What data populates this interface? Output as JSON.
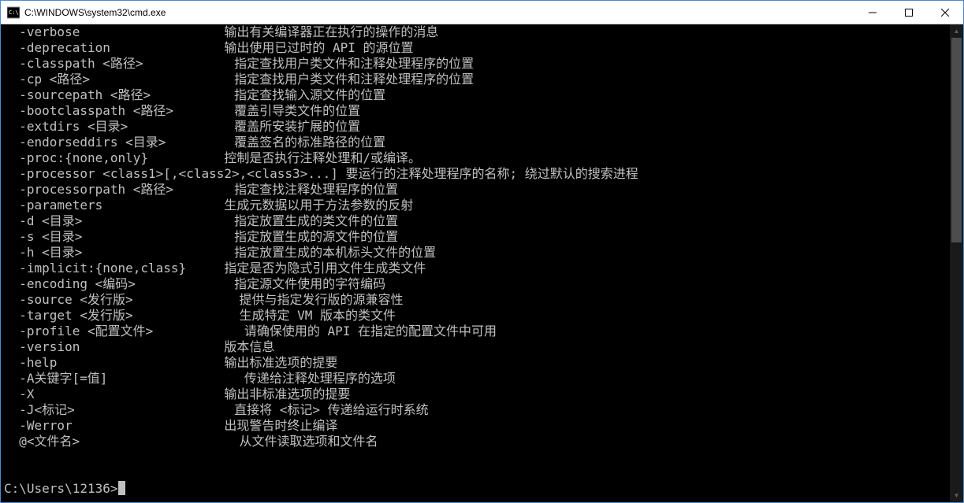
{
  "window": {
    "title": "C:\\WINDOWS\\system32\\cmd.exe"
  },
  "terminal": {
    "lines": [
      "  -verbose                   输出有关编译器正在执行的操作的消息",
      "  -deprecation               输出使用已过时的 API 的源位置",
      "  -classpath <路径>            指定查找用户类文件和注释处理程序的位置",
      "  -cp <路径>                   指定查找用户类文件和注释处理程序的位置",
      "  -sourcepath <路径>           指定查找输入源文件的位置",
      "  -bootclasspath <路径>        覆盖引导类文件的位置",
      "  -extdirs <目录>              覆盖所安装扩展的位置",
      "  -endorseddirs <目录>         覆盖签名的标准路径的位置",
      "  -proc:{none,only}          控制是否执行注释处理和/或编译。",
      "  -processor <class1>[,<class2>,<class3>...] 要运行的注释处理程序的名称; 绕过默认的搜索进程",
      "  -processorpath <路径>        指定查找注释处理程序的位置",
      "  -parameters                生成元数据以用于方法参数的反射",
      "  -d <目录>                    指定放置生成的类文件的位置",
      "  -s <目录>                    指定放置生成的源文件的位置",
      "  -h <目录>                    指定放置生成的本机标头文件的位置",
      "  -implicit:{none,class}     指定是否为隐式引用文件生成类文件",
      "  -encoding <编码>             指定源文件使用的字符编码",
      "  -source <发行版>              提供与指定发行版的源兼容性",
      "  -target <发行版>              生成特定 VM 版本的类文件",
      "  -profile <配置文件>            请确保使用的 API 在指定的配置文件中可用",
      "  -version                   版本信息",
      "  -help                      输出标准选项的提要",
      "  -A关键字[=值]                  传递给注释处理程序的选项",
      "  -X                         输出非标准选项的提要",
      "  -J<标记>                     直接将 <标记> 传递给运行时系统",
      "  -Werror                    出现警告时终止编译",
      "  @<文件名>                     从文件读取选项和文件名",
      "",
      ""
    ],
    "prompt": "C:\\Users\\12136>"
  }
}
